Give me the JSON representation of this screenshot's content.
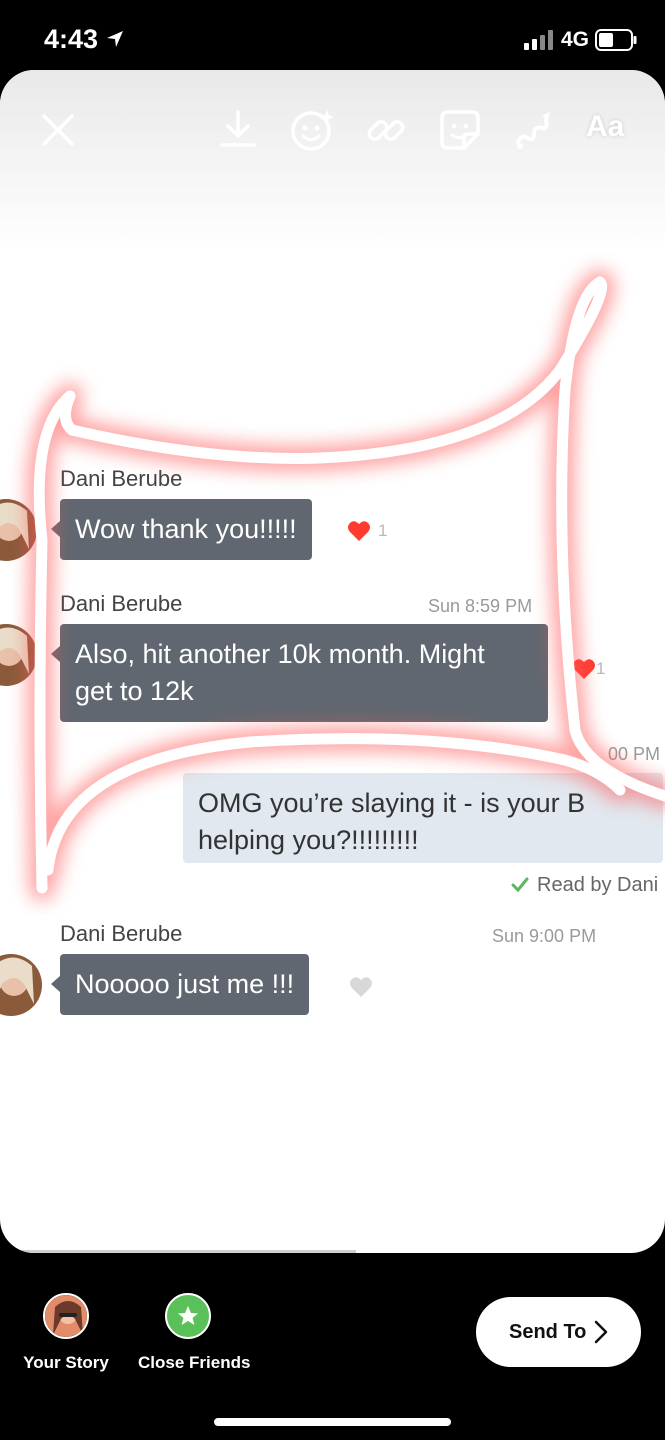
{
  "status_bar": {
    "time": "4:43",
    "network": "4G"
  },
  "toolbar": {
    "close_icon": "close-icon",
    "download_icon": "download-icon",
    "face_effects_icon": "face-effects-icon",
    "link_icon": "link-icon",
    "sticker_icon": "sticker-icon",
    "draw_icon": "draw-icon",
    "text_label": "Aa"
  },
  "chat": {
    "messages": [
      {
        "sender": "Dani Berube",
        "text": "Wow thank you!!!!!",
        "heart_count": "1"
      },
      {
        "sender": "Dani Berube",
        "timestamp": "Sun 8:59 PM",
        "line1": "Also, hit another 10k month. Might",
        "line2": "get to 12k",
        "heart_count": "1"
      },
      {
        "timestamp_partial": "00 PM",
        "line1": "OMG you’re slaying it - is your B",
        "line2": "helping you?!!!!!!!!!"
      },
      {
        "sender": "Dani Berube",
        "timestamp": "Sun 9:00 PM",
        "text": "Nooooo just me !!!"
      }
    ],
    "read_receipt": "Read by Dani"
  },
  "bottom_bar": {
    "your_story": "Your Story",
    "close_friends": "Close Friends",
    "send_to": "Send To"
  },
  "colors": {
    "incoming_bubble": "#616770",
    "outgoing_bubble": "#e1e8ef",
    "heart_red": "#ff3b30",
    "neon_glow": "#ff5a5a",
    "close_friends_green": "#5ac05a"
  }
}
